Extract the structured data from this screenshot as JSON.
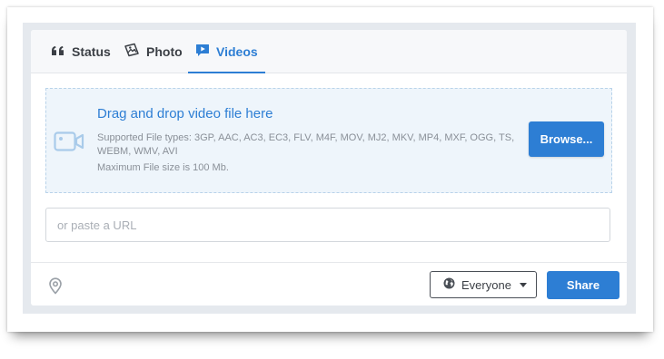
{
  "tabs": [
    {
      "label": "Status",
      "icon": "quote-icon",
      "active": false
    },
    {
      "label": "Photo",
      "icon": "photo-icon",
      "active": false
    },
    {
      "label": "Videos",
      "icon": "video-icon",
      "active": true
    }
  ],
  "upload": {
    "title": "Drag and drop video file here",
    "supported_types": "Supported File types: 3GP, AAC, AC3, EC3, FLV, M4F, MOV, MJ2, MKV, MP4, MXF, OGG, TS, WEBM, WMV, AVI",
    "max_size": "Maximum File size is 100 Mb.",
    "browse_label": "Browse..."
  },
  "url_input": {
    "placeholder": "or paste a URL",
    "value": ""
  },
  "footer": {
    "audience": "Everyone",
    "share_label": "Share"
  },
  "colors": {
    "accent": "#2d7ed4",
    "dropzone_bg": "#eef5fb",
    "page_bg": "#e5e9ee"
  }
}
